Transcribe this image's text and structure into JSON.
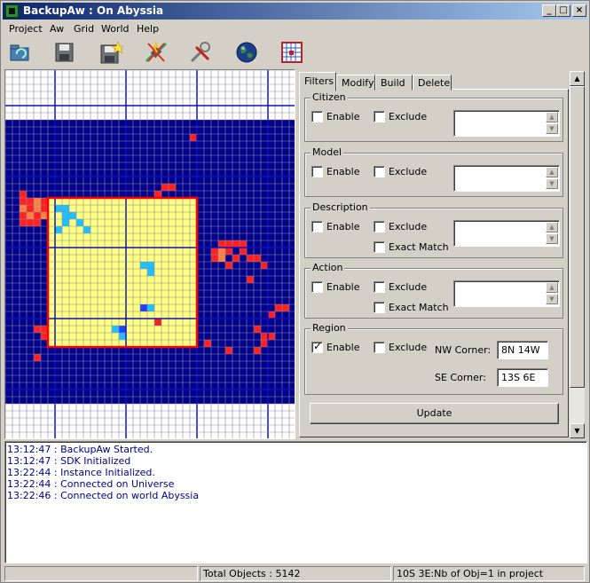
{
  "window": {
    "title": "BackupAw : On Abyssia"
  },
  "menu": [
    "Project",
    "Aw",
    "Grid",
    "World",
    "Help"
  ],
  "toolbar": [
    {
      "icon": "refresh-folder-icon"
    },
    {
      "icon": "save-icon"
    },
    {
      "icon": "save-as-icon"
    },
    {
      "icon": "disconnect-icon"
    },
    {
      "icon": "tools-icon"
    },
    {
      "icon": "globe-icon"
    },
    {
      "icon": "grid-icon"
    }
  ],
  "tabs": [
    "Filters",
    "Modify",
    "Build",
    "Delete"
  ],
  "filters": {
    "citizen": {
      "title": "Citizen",
      "enable": "Enable",
      "exclude": "Exclude"
    },
    "model": {
      "title": "Model",
      "enable": "Enable",
      "exclude": "Exclude"
    },
    "description": {
      "title": "Description",
      "enable": "Enable",
      "exclude": "Exclude",
      "exact": "Exact Match"
    },
    "action": {
      "title": "Action",
      "enable": "Enable",
      "exclude": "Exclude",
      "exact": "Exact Match"
    },
    "region": {
      "title": "Region",
      "enable": "Enable",
      "exclude": "Exclude",
      "nw_label": "NW Corner:",
      "nw_value": "8N 14W",
      "se_label": "SE Corner:",
      "se_value": "13S 6E",
      "enabled": true
    }
  },
  "update_button": "Update",
  "log": [
    "13:12:47 : BackupAw Started.",
    "13:12:47 : SDK Initialized",
    "13:22:44 : Instance Initialized.",
    "13:22:44 : Connected on Universe",
    "13:22:46 : Connected on world Abyssia"
  ],
  "status": {
    "left": "",
    "total": "Total Objects : 5142",
    "right": "10S 3E:Nb of Obj=1 in project"
  },
  "colors": {
    "grid_blue": "#00008b",
    "selection_yellow": "#ffff80",
    "selection_border": "#ff0000",
    "hot_red": "#ff2020",
    "hot_cyan": "#20c0ff"
  }
}
